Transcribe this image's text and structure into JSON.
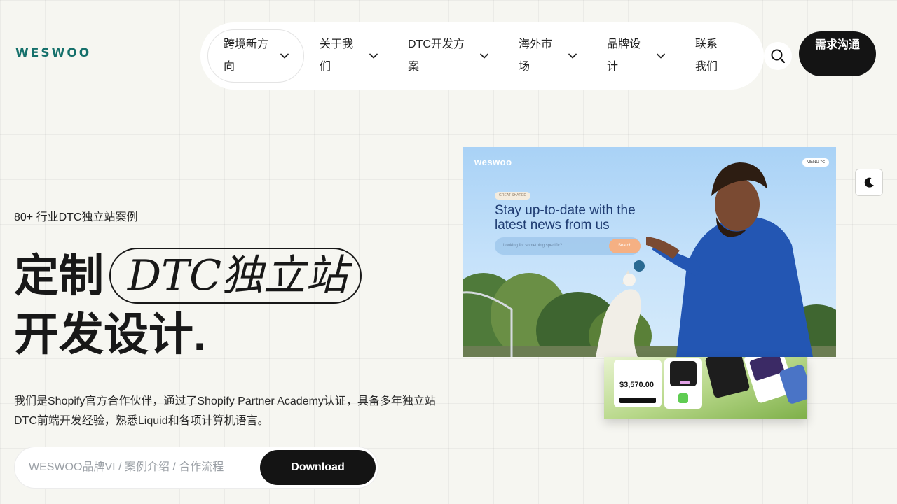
{
  "brand": {
    "logo_text": "WESWOO"
  },
  "nav": {
    "items": [
      {
        "label": "跨境新方向"
      },
      {
        "label": "关于我们"
      },
      {
        "label": "DTC开发方案"
      },
      {
        "label": "海外市场"
      },
      {
        "label": "品牌设计"
      },
      {
        "label": "联系我们"
      }
    ],
    "contact_label": "需求沟通"
  },
  "hero": {
    "eyebrow": "80+ 行业DTC独立站案例",
    "headline_part1": "定制",
    "headline_pill": "DTC独立站",
    "headline_part2": "开发设计.",
    "description": "我们是Shopify官方合作伙伴，通过了Shopify Partner Academy认证，具备多年独立站DTC前端开发经验，熟悉Liquid和各项计算机语言。",
    "input_placeholder": "WESWOO品牌VI / 案例介绍 / 合作流程",
    "download_label": "Download"
  },
  "mock": {
    "logo": "weswoo",
    "menu": "MENU ⌥",
    "tag": "GREAT SHARED",
    "title": "Stay up-to-date with the latest news from us",
    "input_placeholder": "Looking for something specific?",
    "search_label": "Search",
    "card_amount": "$3,570.00"
  },
  "colors": {
    "brand_teal": "#15706b",
    "dark_button": "#141414",
    "page_bg": "#f6f6f1"
  },
  "icons": [
    "chevron-down-icon",
    "search-icon",
    "moon-icon"
  ]
}
